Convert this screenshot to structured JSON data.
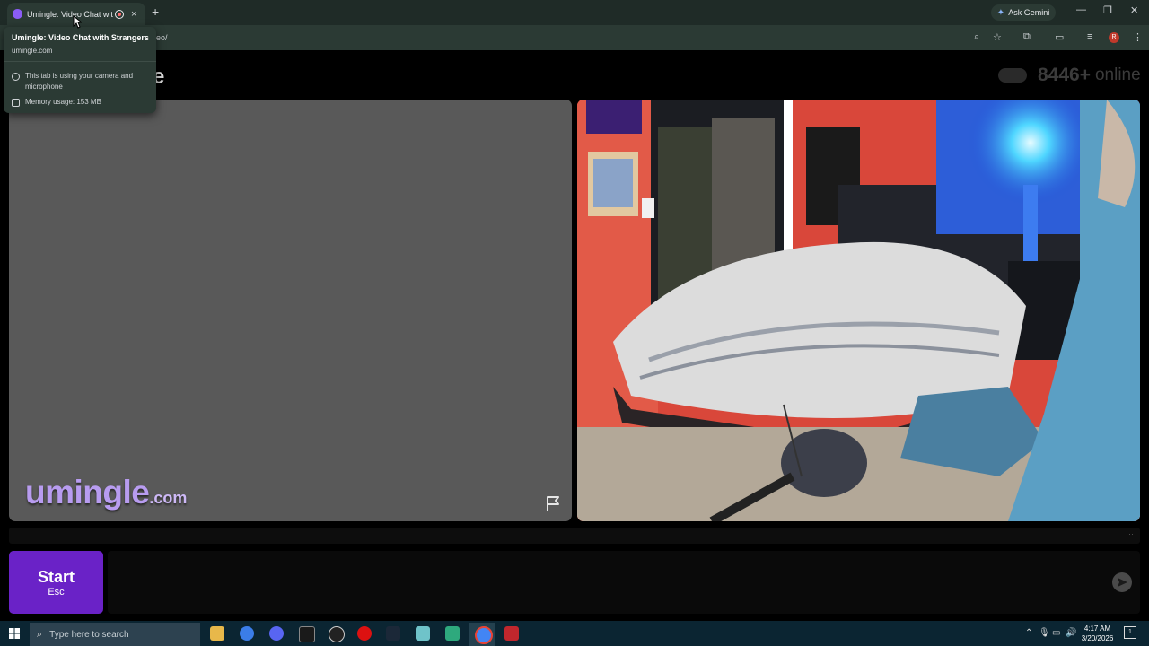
{
  "browser": {
    "tab_title": "Umingle: Video Chat with Strangers",
    "tab_close": "×",
    "new_tab": "+",
    "ask_gemini": "Ask Gemini",
    "url_partial": "eo/",
    "profile_initial": "R",
    "colors": {
      "tab_bar": "#1f2b27",
      "toolbar": "#2b3a34",
      "favicon": "#8b5cf6"
    }
  },
  "tooltip": {
    "title": "Umingle: Video Chat with Strangers",
    "url": "umingle.com",
    "camera_notice": "This tab is using your camera and microphone",
    "memory": "Memory usage: 153 MB"
  },
  "site": {
    "online_count": "8446+",
    "online_label": "online",
    "logo_stub": "e",
    "watermark_main": "umingle",
    "watermark_tld": ".com",
    "start_label": "Start",
    "start_hint": "Esc",
    "strip_dots": "···",
    "colors": {
      "accent": "#6a22c7",
      "watermark": "#b89cf0",
      "video_bg": "#595959"
    }
  },
  "taskbar": {
    "search_placeholder": "Type here to search",
    "time": "4:17 AM",
    "date": "3/20/2026",
    "notification_count": "1",
    "colors": {
      "background": "#0b2532"
    }
  }
}
